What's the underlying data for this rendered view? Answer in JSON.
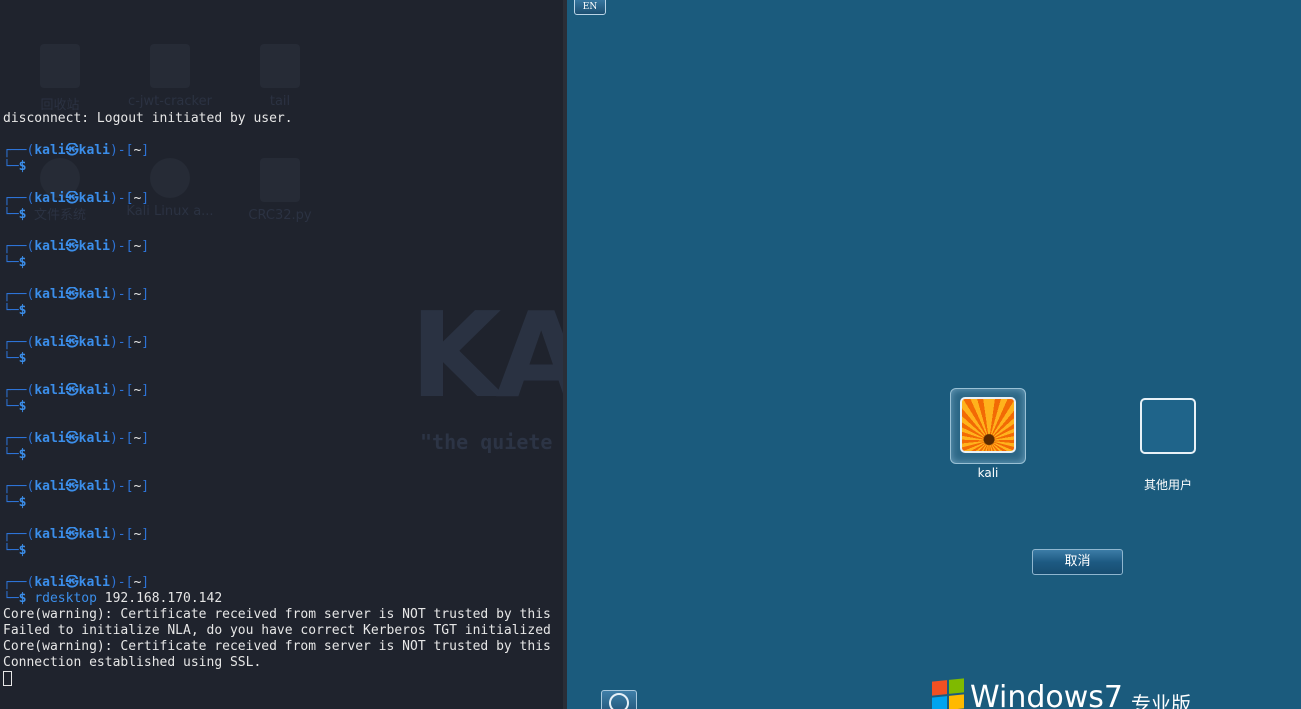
{
  "desktop": {
    "icons": [
      {
        "label": "回收站",
        "icon": "trash-icon"
      },
      {
        "label": "c-jwt-cracker",
        "icon": "locked-folder-icon"
      },
      {
        "label": "tail",
        "icon": "folder-icon"
      },
      {
        "label": "文件系统",
        "icon": "drive-icon"
      },
      {
        "label": "Kali Linux a...",
        "icon": "disc-icon"
      },
      {
        "label": "CRC32.py",
        "icon": "python-file-icon"
      }
    ],
    "watermark": "KA",
    "tagline": "\"the quiete"
  },
  "terminal": {
    "user": "kali",
    "host": "kali",
    "dir": "~",
    "disconnect_line": "disconnect: Logout initiated by user.",
    "command": "rdesktop",
    "command_arg": " 192.168.170.142",
    "output": [
      "Core(warning): Certificate received from server is NOT trusted by this",
      "Failed to initialize NLA, do you have correct Kerberos TGT initialized",
      "Core(warning): Certificate received from server is NOT trusted by this",
      "Connection established using SSL."
    ]
  },
  "rdp": {
    "lang": "EN",
    "accounts": [
      {
        "name": "kali",
        "icon": "flower-avatar-icon"
      },
      {
        "name": "其他用户",
        "icon": "blank-avatar-icon"
      }
    ],
    "cancel_label": "取消",
    "brand_word": "Windows",
    "brand_version": "7",
    "brand_edition": "专业版",
    "colors": {
      "background": "#1b5b7d",
      "terminal_bg": "#1f232d",
      "prompt": "#3b8eea"
    }
  }
}
